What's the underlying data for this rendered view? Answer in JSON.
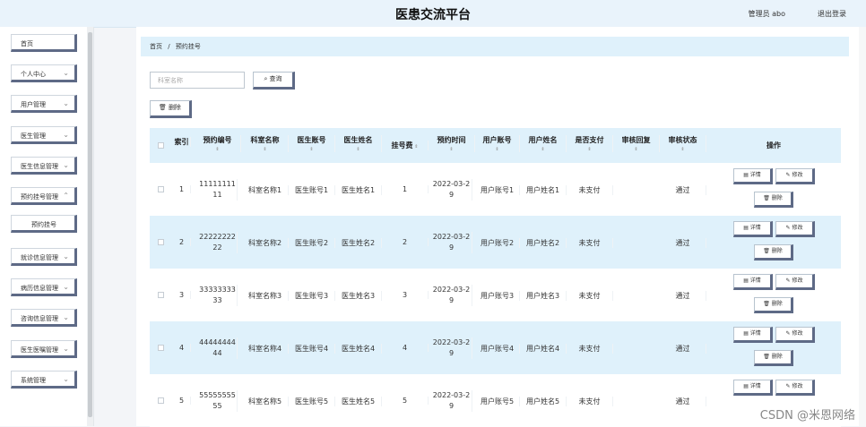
{
  "header": {
    "title": "医患交流平台",
    "user": "管理员 abo",
    "logout": "退出登录"
  },
  "sidebar": {
    "items": [
      {
        "label": "首页",
        "top": 0
      },
      {
        "label": "个人中心"
      },
      {
        "label": "用户管理"
      },
      {
        "label": "医生管理"
      },
      {
        "label": "医生信息管理"
      },
      {
        "label": "预约挂号管理"
      },
      {
        "label": "预约挂号"
      },
      {
        "label": "就诊信息管理"
      },
      {
        "label": "病历信息管理"
      },
      {
        "label": "咨询信息管理"
      },
      {
        "label": "医生医嘱管理"
      },
      {
        "label": "系统管理"
      }
    ]
  },
  "breadcrumb": {
    "home": "首页",
    "sep": "/",
    "current": "预约挂号"
  },
  "search": {
    "placeholder": "科室名称",
    "query_label": "查询",
    "delete_label": "删除"
  },
  "table": {
    "headers": [
      "",
      "索引",
      "预约编号",
      "科室名称",
      "医生账号",
      "医生姓名",
      "挂号费",
      "预约时间",
      "用户账号",
      "用户姓名",
      "是否支付",
      "审核回复",
      "审核状态",
      "操作"
    ],
    "rows": [
      {
        "index": "1",
        "id": "11111111 11",
        "dept": "科室名称1",
        "doc_acc": "医生账号1",
        "doc_name": "医生姓名1",
        "fee": "1",
        "time": "2022-03-2 9",
        "user_acc": "用户账号1",
        "user_name": "用户姓名1",
        "paid": "未支付",
        "reply": "",
        "status": "通过"
      },
      {
        "index": "2",
        "id": "22222222 22",
        "dept": "科室名称2",
        "doc_acc": "医生账号2",
        "doc_name": "医生姓名2",
        "fee": "2",
        "time": "2022-03-2 9",
        "user_acc": "用户账号2",
        "user_name": "用户姓名2",
        "paid": "未支付",
        "reply": "",
        "status": "通过"
      },
      {
        "index": "3",
        "id": "33333333 33",
        "dept": "科室名称3",
        "doc_acc": "医生账号3",
        "doc_name": "医生姓名3",
        "fee": "3",
        "time": "2022-03-2 9",
        "user_acc": "用户账号3",
        "user_name": "用户姓名3",
        "paid": "未支付",
        "reply": "",
        "status": "通过"
      },
      {
        "index": "4",
        "id": "44444444 44",
        "dept": "科室名称4",
        "doc_acc": "医生账号4",
        "doc_name": "医生姓名4",
        "fee": "4",
        "time": "2022-03-2 9",
        "user_acc": "用户账号4",
        "user_name": "用户姓名4",
        "paid": "未支付",
        "reply": "",
        "status": "通过"
      },
      {
        "index": "5",
        "id": "55555555 55",
        "dept": "科室名称5",
        "doc_acc": "医生账号5",
        "doc_name": "医生姓名5",
        "fee": "5",
        "time": "2022-03-2 9",
        "user_acc": "用户账号5",
        "user_name": "用户姓名5",
        "paid": "未支付",
        "reply": "",
        "status": "通过"
      }
    ],
    "ops": {
      "detail": "详情",
      "edit": "修改",
      "delete": "删除"
    }
  },
  "watermark": "CSDN @米恩网络"
}
